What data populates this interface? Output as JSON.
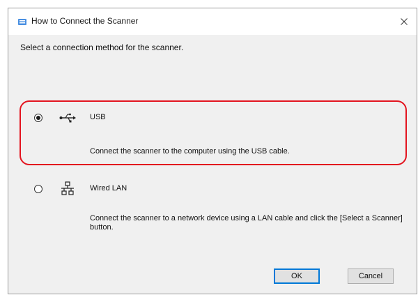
{
  "window": {
    "title": "How to Connect the Scanner",
    "close_glyph": "×",
    "app_icon": "scanner-app-icon"
  },
  "instruction": "Select a connection method for the scanner.",
  "options": [
    {
      "id": "usb",
      "label": "USB",
      "description": "Connect the scanner to the computer using the USB cable.",
      "selected": true,
      "icon": "usb-icon",
      "highlighted": true
    },
    {
      "id": "wired-lan",
      "label": "Wired LAN",
      "description": "Connect the scanner to a network device using a LAN cable and click the [Select a Scanner] button.",
      "selected": false,
      "icon": "network-icon",
      "highlighted": false
    }
  ],
  "buttons": {
    "ok_label": "OK",
    "cancel_label": "Cancel"
  },
  "colors": {
    "highlight": "#e3141f",
    "accent": "#0078d7",
    "client_bg": "#f0f0f0"
  }
}
